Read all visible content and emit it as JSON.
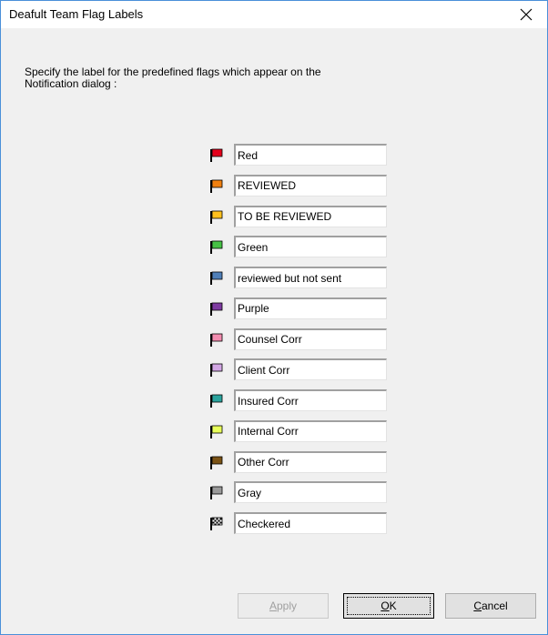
{
  "dialog": {
    "title": "Deafult Team Flag Labels",
    "close_symbol": "×",
    "instruction": "Specify the label for the predefined flags which appear on the\nNotification dialog :"
  },
  "flags": [
    {
      "icon": "red-flag-icon",
      "color": "#e3001b",
      "label": "Red"
    },
    {
      "icon": "orange-flag-icon",
      "color": "#f08010",
      "label": "REVIEWED"
    },
    {
      "icon": "yellow-flag-icon",
      "color": "#ffc11e",
      "label": "TO BE REVIEWED"
    },
    {
      "icon": "green-flag-icon",
      "color": "#46c145",
      "label": "Green"
    },
    {
      "icon": "blue-flag-icon",
      "color": "#4f7fb8",
      "label": "reviewed but not sent"
    },
    {
      "icon": "purple-flag-icon",
      "color": "#7d3aa0",
      "label": "Purple"
    },
    {
      "icon": "pink-flag-icon",
      "color": "#f28caf",
      "label": "Counsel Corr"
    },
    {
      "icon": "lavender-flag-icon",
      "color": "#d2a6e4",
      "label": "Client Corr"
    },
    {
      "icon": "teal-flag-icon",
      "color": "#2aa39d",
      "label": "Insured Corr"
    },
    {
      "icon": "lime-flag-icon",
      "color": "#e8ff5a",
      "label": "Internal Corr"
    },
    {
      "icon": "brown-flag-icon",
      "color": "#7a5214",
      "label": "Other Corr"
    },
    {
      "icon": "gray-flag-icon",
      "color": "#9a9a9a",
      "label": "Gray"
    },
    {
      "icon": "checkered-flag-icon",
      "color": "checkered",
      "label": "Checkered"
    }
  ],
  "buttons": {
    "apply": {
      "mnemonic": "A",
      "rest": "pply",
      "enabled": false
    },
    "ok": {
      "mnemonic": "O",
      "rest": "K"
    },
    "cancel": {
      "mnemonic": "C",
      "rest": "ancel"
    }
  }
}
